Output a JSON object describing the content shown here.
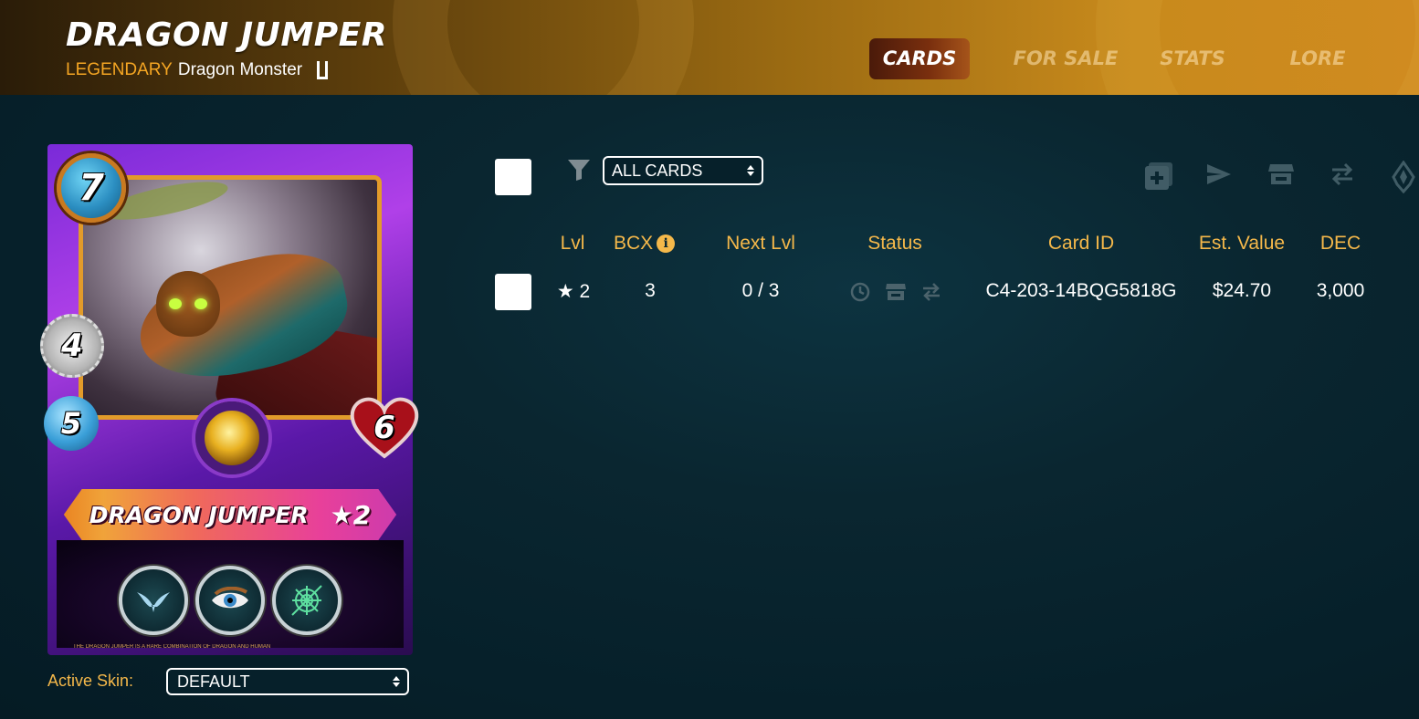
{
  "header": {
    "title": "DRAGON JUMPER",
    "rarity": "LEGENDARY",
    "type_line": "Dragon Monster",
    "edition_icon": "edition-icon",
    "tabs": [
      {
        "label": "CARDS",
        "active": true
      },
      {
        "label": "FOR SALE",
        "active": false
      },
      {
        "label": "STATS",
        "active": false
      },
      {
        "label": "LORE",
        "active": false
      }
    ]
  },
  "card": {
    "name": "DRAGON JUMPER",
    "level": "★2",
    "mana": "7",
    "attack": "4",
    "speed": "5",
    "health": "6",
    "abilities": [
      "flying-icon",
      "true-strike-icon",
      "snare-icon"
    ],
    "footer_text": "THE DRAGON JUMPER IS A RARE COMBINATION OF DRAGON AND HUMAN"
  },
  "skin": {
    "label": "Active Skin:",
    "selected": "DEFAULT"
  },
  "filter": {
    "icon": "filter-icon",
    "selected": "ALL CARDS"
  },
  "toolbar_icons": [
    "combine-icon",
    "send-icon",
    "market-icon",
    "transfer-icon",
    "burn-icon"
  ],
  "table": {
    "headers": [
      "Lvl",
      "BCX",
      "Next Lvl",
      "Status",
      "Card ID",
      "Est. Value",
      "DEC"
    ],
    "bcx_info_icon": "info-icon",
    "rows": [
      {
        "lvl": "★ 2",
        "bcx": "3",
        "next_lvl": "0 / 3",
        "status_icons": [
          "clock-icon",
          "market-icon",
          "transfer-icon"
        ],
        "card_id": "C4-203-14BQG5818G",
        "est_value": "$24.70",
        "dec": "3,000"
      }
    ]
  },
  "colors": {
    "accent": "#f5b84a",
    "rarity": "#f5a623",
    "background": "#0a2630",
    "tab_active": "#7a2f0e"
  }
}
